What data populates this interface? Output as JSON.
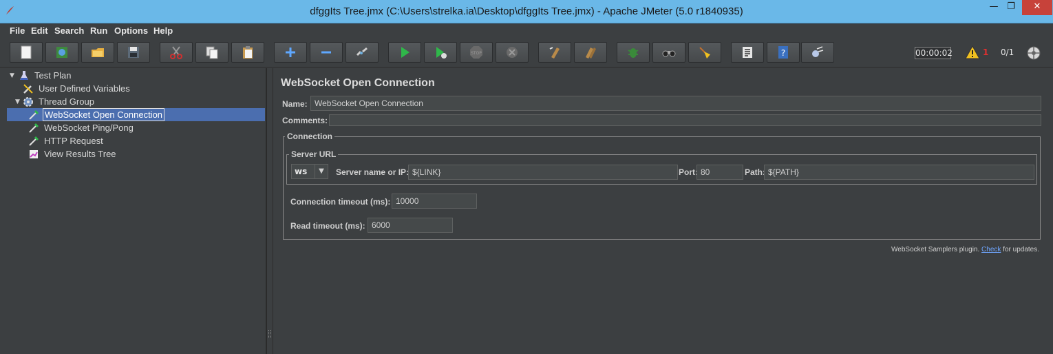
{
  "window": {
    "title": "dfggIts Tree.jmx (C:\\Users\\strelka.ia\\Desktop\\dfggIts Tree.jmx) - Apache JMeter (5.0 r1840935)",
    "minimize": "—",
    "maximize": "❐",
    "close": "✕"
  },
  "menu": [
    "File",
    "Edit",
    "Search",
    "Run",
    "Options",
    "Help"
  ],
  "toolbar": {
    "buttons": [
      "new-icon",
      "templates-icon",
      "open-icon",
      "save-icon",
      "cut-icon",
      "copy-icon",
      "paste-icon",
      "expand-icon",
      "collapse-icon",
      "toggle-icon",
      "start-icon",
      "start-no-pauses-icon",
      "stop-icon",
      "shutdown-icon",
      "clear-icon",
      "clear-all-icon",
      "function-helper-icon",
      "search-icon",
      "reset-search-icon",
      "log-viewer-icon",
      "help-icon",
      "remote-icon"
    ],
    "timer": "00:00:02",
    "warning_count": "1",
    "threads": "0/1"
  },
  "tree": {
    "items": [
      {
        "label": "Test Plan",
        "icon": "flask-icon"
      },
      {
        "label": "User Defined Variables",
        "icon": "wrench-icon"
      },
      {
        "label": "Thread Group",
        "icon": "gear-icon"
      },
      {
        "label": "WebSocket Open Connection",
        "icon": "pipette-icon"
      },
      {
        "label": "WebSocket Ping/Pong",
        "icon": "pipette-icon"
      },
      {
        "label": "HTTP Request",
        "icon": "pipette-icon"
      },
      {
        "label": "View Results Tree",
        "icon": "chart-icon"
      }
    ]
  },
  "panel": {
    "title": "WebSocket Open Connection",
    "name_label": "Name:",
    "name_value": "WebSocket Open Connection",
    "comments_label": "Comments:",
    "connection_title": "Connection",
    "server_url_title": "Server URL",
    "scheme": "ws",
    "server_label": "Server name or IP:",
    "server_value": "${LINK}",
    "port_label": "Port:",
    "port_value": "80",
    "path_label": "Path:",
    "path_value": "${PATH}",
    "conn_timeout_label": "Connection timeout (ms):",
    "conn_timeout_value": "10000",
    "read_timeout_label": "Read timeout (ms):",
    "read_timeout_value": "6000",
    "footer_prefix": "WebSocket Samplers plugin. ",
    "footer_link": "Check",
    "footer_suffix": " for updates."
  }
}
